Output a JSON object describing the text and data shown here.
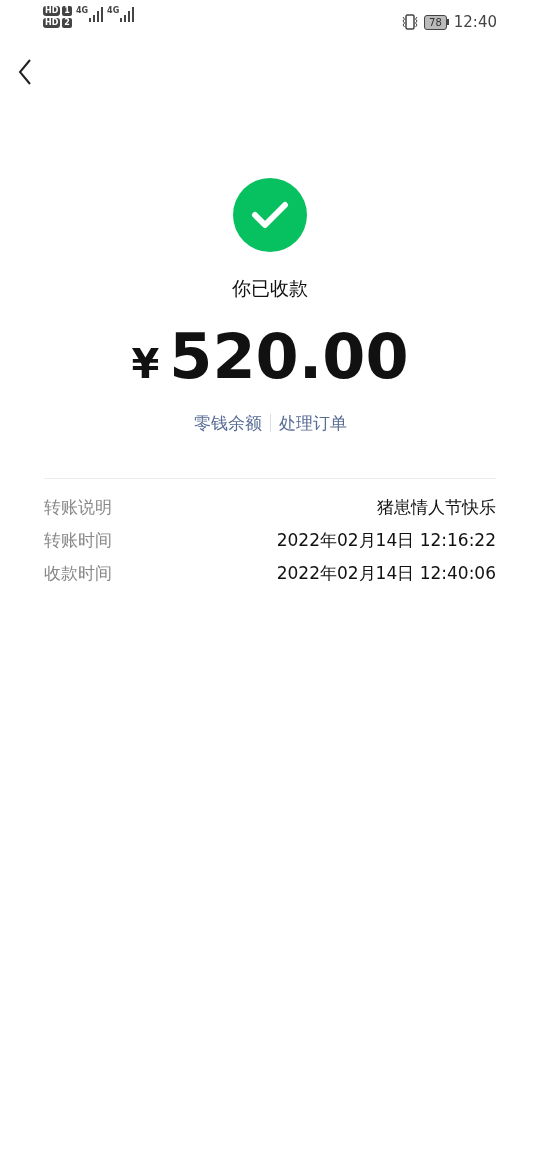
{
  "status_bar": {
    "sims": [
      {
        "badge": "HD",
        "slot": "1",
        "network": "4G"
      },
      {
        "badge": "HD",
        "slot": "2",
        "network": "4G"
      }
    ],
    "battery": "78",
    "time": "12:40"
  },
  "title": "你已收款",
  "amount": {
    "currency": "¥",
    "value": "520.00"
  },
  "links": [
    "零钱余额",
    "处理订单"
  ],
  "details": [
    {
      "label": "转账说明",
      "value": "猪崽情人节快乐"
    },
    {
      "label": "转账时间",
      "value": "2022年02月14日 12:16:22"
    },
    {
      "label": "收款时间",
      "value": "2022年02月14日 12:40:06"
    }
  ]
}
